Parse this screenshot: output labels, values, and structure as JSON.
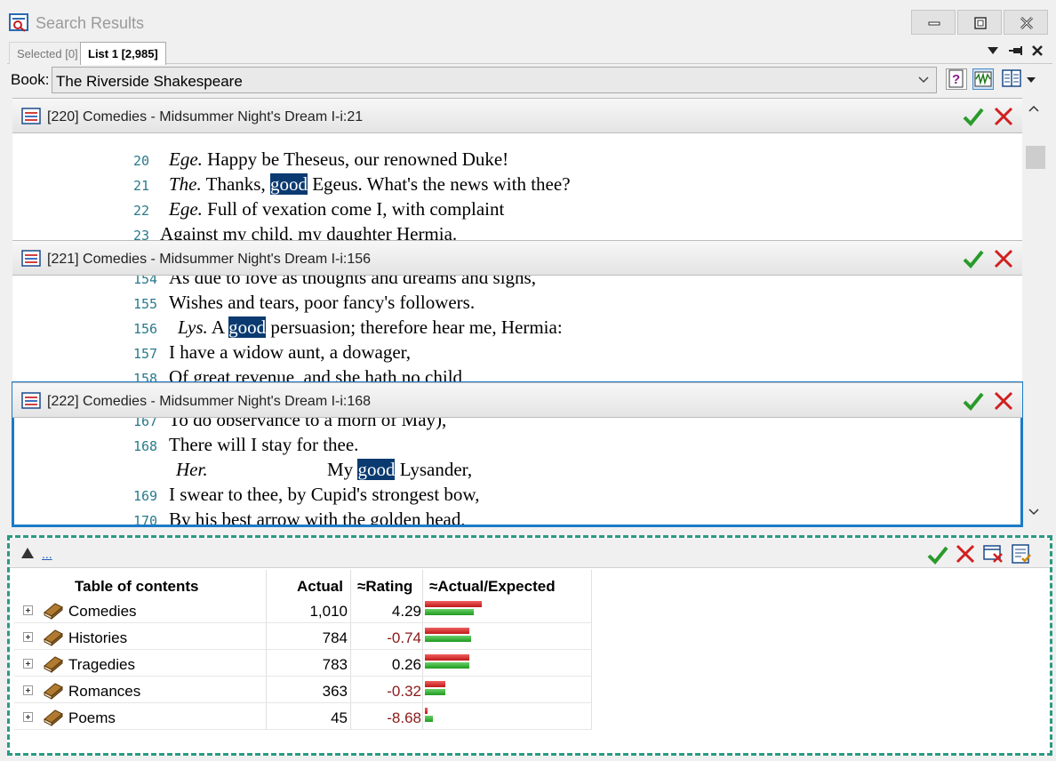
{
  "window": {
    "title": "Search Results"
  },
  "tabs": {
    "selected": "Selected [0]",
    "list1": "List 1 [2,985]"
  },
  "toolbar": {
    "book_label": "Book:",
    "book_value": "The Riverside Shakespeare"
  },
  "results": [
    {
      "header": "[220] Comedies - Midsummer Night's Dream I-i:21",
      "lines": [
        {
          "num": "20",
          "pre": "Ege.",
          "text": " Happy be Theseus, our renowned Duke!"
        },
        {
          "num": "21",
          "pre": "The.",
          "text_a": " Thanks, ",
          "hl": "good",
          "text_b": " Egeus. What's the news with thee?"
        },
        {
          "num": "22",
          "pre": "Ege.",
          "text": " Full of vexation come I, with complaint"
        },
        {
          "num": "23",
          "text": "Against my child, my daughter Hermia."
        }
      ]
    },
    {
      "header": "[221] Comedies - Midsummer Night's Dream I-i:156",
      "lines": [
        {
          "num": "154",
          "text": "As due to love as thoughts and dreams and sighs,"
        },
        {
          "num": "155",
          "text": "Wishes and tears, poor fancy's followers."
        },
        {
          "num": "156",
          "pre": "Lys.",
          "text_a": " A ",
          "hl": "good",
          "text_b": " persuasion; therefore hear me, Hermia:"
        },
        {
          "num": "157",
          "text": "I have a widow aunt, a dowager,"
        },
        {
          "num": "158",
          "text": "Of great revenue, and she hath no child"
        }
      ]
    },
    {
      "header": "[222] Comedies - Midsummer Night's Dream I-i:168",
      "lines": [
        {
          "num": "167",
          "text": "To do observance to a morn of May),"
        },
        {
          "num": "168",
          "text": "There will I stay for thee."
        },
        {
          "pre": "Her.",
          "text_a": "My ",
          "hl": "good",
          "text_b": " Lysander,"
        },
        {
          "num": "169",
          "text": "I swear to thee, by Cupid's strongest bow,"
        },
        {
          "num": "170",
          "text": "By his best arrow with the golden head,"
        }
      ]
    }
  ],
  "toc": {
    "link": "...",
    "columns": {
      "name": "Table of contents",
      "actual": "Actual",
      "rating": "≈Rating",
      "ratio": "≈Actual/Expected"
    },
    "rows": [
      {
        "name": "Comedies",
        "actual": "1,010",
        "rating": "4.29",
        "negative": false,
        "actual_ratio": 1.0,
        "expected_ratio": 0.86
      },
      {
        "name": "Histories",
        "actual": "784",
        "rating": "-0.74",
        "negative": true,
        "actual_ratio": 0.78,
        "expected_ratio": 0.81
      },
      {
        "name": "Tragedies",
        "actual": "783",
        "rating": "0.26",
        "negative": false,
        "actual_ratio": 0.78,
        "expected_ratio": 0.78
      },
      {
        "name": "Romances",
        "actual": "363",
        "rating": "-0.32",
        "negative": true,
        "actual_ratio": 0.36,
        "expected_ratio": 0.36
      },
      {
        "name": "Poems",
        "actual": "45",
        "rating": "-8.68",
        "negative": true,
        "actual_ratio": 0.05,
        "expected_ratio": 0.14
      }
    ]
  },
  "colors": {
    "highlight": "#0a3a70",
    "line_number": "#2a7a8c",
    "negative_rating": "#8a1a1a",
    "panel_border": "#2a9a84",
    "active_border": "#1c7bc8"
  }
}
